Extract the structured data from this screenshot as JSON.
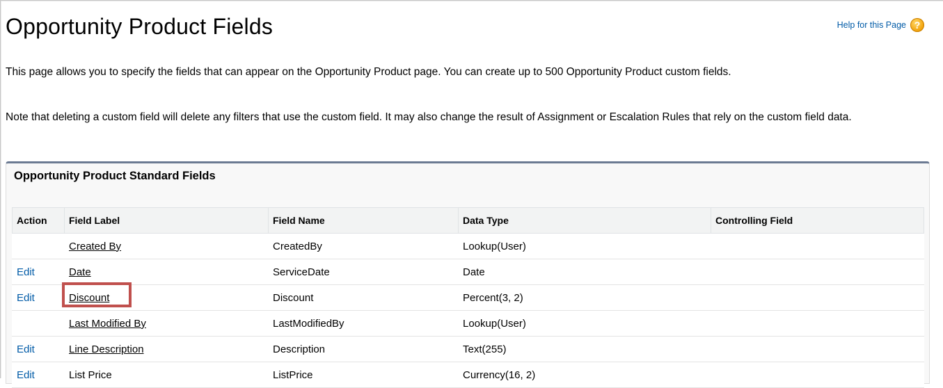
{
  "page": {
    "title": "Opportunity Product Fields",
    "help_label": "Help for this Page",
    "help_icon": "question-icon",
    "intro": "This page allows you to specify the fields that can appear on the Opportunity Product page. You can create up to 500 Opportunity Product custom fields.",
    "note": "Note that deleting a custom field will delete any filters that use the custom field. It may also change the result of Assignment or Escalation Rules that rely on the custom field data."
  },
  "section": {
    "title": "Opportunity Product Standard Fields",
    "columns": {
      "action": "Action",
      "label": "Field Label",
      "name": "Field Name",
      "type": "Data Type",
      "controlling": "Controlling Field"
    },
    "rows": [
      {
        "action": "",
        "label": "Created By",
        "name": "CreatedBy",
        "type": "Lookup(User)",
        "controlling": ""
      },
      {
        "action": "Edit",
        "label": "Date",
        "name": "ServiceDate",
        "type": "Date",
        "controlling": ""
      },
      {
        "action": "Edit",
        "label": "Discount",
        "name": "Discount",
        "type": "Percent(3, 2)",
        "controlling": ""
      },
      {
        "action": "",
        "label": "Last Modified By",
        "name": "LastModifiedBy",
        "type": "Lookup(User)",
        "controlling": ""
      },
      {
        "action": "Edit",
        "label": "Line Description",
        "name": "Description",
        "type": "Text(255)",
        "controlling": ""
      },
      {
        "action": "Edit",
        "label": "List Price",
        "name": "ListPrice",
        "type": "Currency(16, 2)",
        "controlling": ""
      }
    ]
  },
  "colors": {
    "link": "#015ba7",
    "section_border": "#6b7a92",
    "highlight": "#c0504d",
    "help_icon": "#f3a712"
  }
}
